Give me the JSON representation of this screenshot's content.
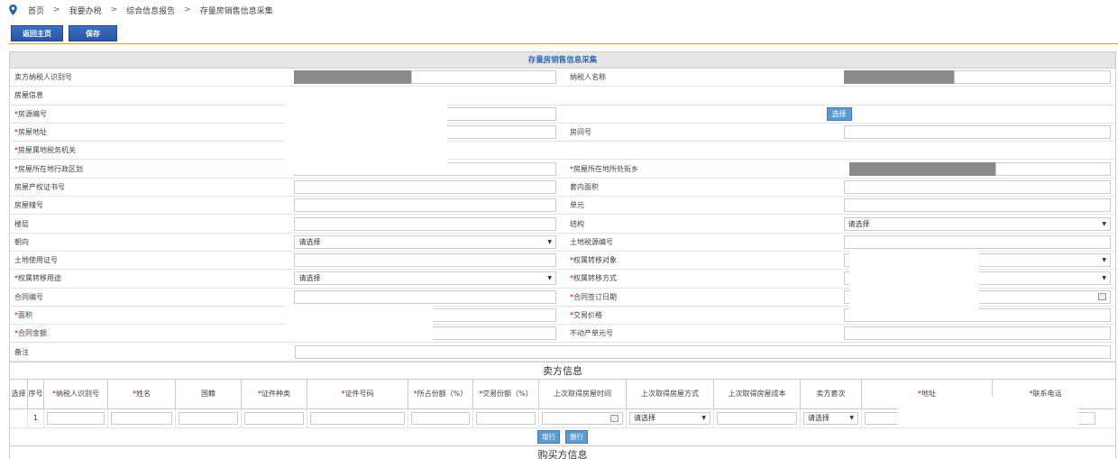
{
  "breadcrumb": {
    "items": [
      "首页",
      "我要办税",
      "综合信息报告",
      "存量房销售信息采集"
    ],
    "separator": ">"
  },
  "toolbar": {
    "back_label": "返回主页",
    "save_label": "保存"
  },
  "form": {
    "title": "存量房销售信息采集",
    "seller_tax_id_label": "卖方纳税人识别号",
    "taxpayer_name_label": "纳税人名称",
    "house_info_label": "房屋信息",
    "source_no_label": "房源编号",
    "select_button": "选择",
    "address_label": "房屋地址",
    "room_no_label": "房间号",
    "tax_authority_label": "房屋属地税务机关",
    "district_label": "房屋所在地行政区划",
    "street_label": "房屋所在地所处街乡",
    "cert_no_label": "房屋产权证书号",
    "inner_area_label": "套内面积",
    "building_no_label": "房屋幢号",
    "unit_label": "单元",
    "floor_label": "楼层",
    "structure_label": "结构",
    "structure_value": "请选择",
    "orientation_label": "朝向",
    "orientation_value": "请选择",
    "land_source_label": "土地税源编号",
    "land_cert_label": "土地使用证号",
    "transfer_object_label": "权属转移对象",
    "transfer_use_label": "权属转移用途",
    "transfer_use_value": "请选择",
    "transfer_method_label": "权属转移方式",
    "contract_no_label": "合同编号",
    "contract_date_label": "合同签订日期",
    "area_label": "面积",
    "trade_price_label": "交易价格",
    "contract_amount_label": "合同金额",
    "property_unit_label": "不动产单元号",
    "remark_label": "备注"
  },
  "seller": {
    "title": "卖方信息",
    "columns": [
      "选择",
      "序号",
      "纳税人识别号",
      "姓名",
      "国籍",
      "证件种类",
      "证件号码",
      "所占份额（%）",
      "交易份额（%）",
      "上次取得房屋时间",
      "上次取得房屋方式",
      "上次取得房屋成本",
      "卖方套次",
      "地址",
      "联系电话"
    ],
    "rows": [
      {
        "index": "1",
        "method_value": "请选择",
        "times_value": "请选择"
      }
    ],
    "add_button": "增行",
    "delete_button": "删行"
  },
  "buyer": {
    "title": "购买方信息"
  }
}
